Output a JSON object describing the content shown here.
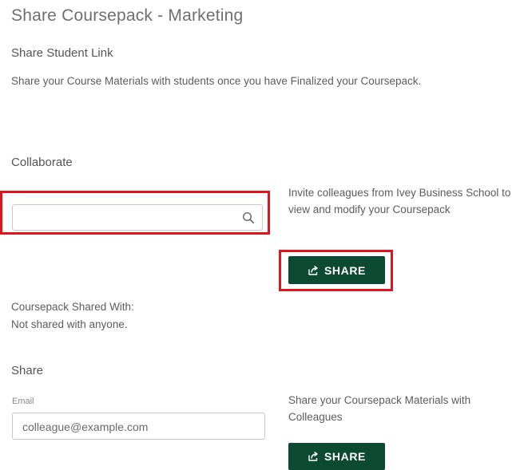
{
  "page": {
    "title": "Share Coursepack - Marketing"
  },
  "student_link": {
    "heading": "Share Student Link",
    "description": "Share your Course Materials with students once you have Finalized your Coursepack."
  },
  "collaborate": {
    "heading": "Collaborate",
    "search_value": "",
    "search_icon": "search-icon",
    "invite_text": "Invite colleagues from Ivey Business School to view and modify your Coursepack",
    "share_button_label": "SHARE",
    "share_icon": "share-icon"
  },
  "shared_with": {
    "label": "Coursepack Shared With:",
    "value": "Not shared with anyone."
  },
  "share": {
    "heading": "Share",
    "email_label": "Email",
    "email_placeholder": "colleague@example.com",
    "description": "Share your Coursepack Materials with Colleagues",
    "share_button_label": "SHARE"
  },
  "colors": {
    "button_bg": "#0c4a33",
    "highlight": "#e0141e"
  }
}
